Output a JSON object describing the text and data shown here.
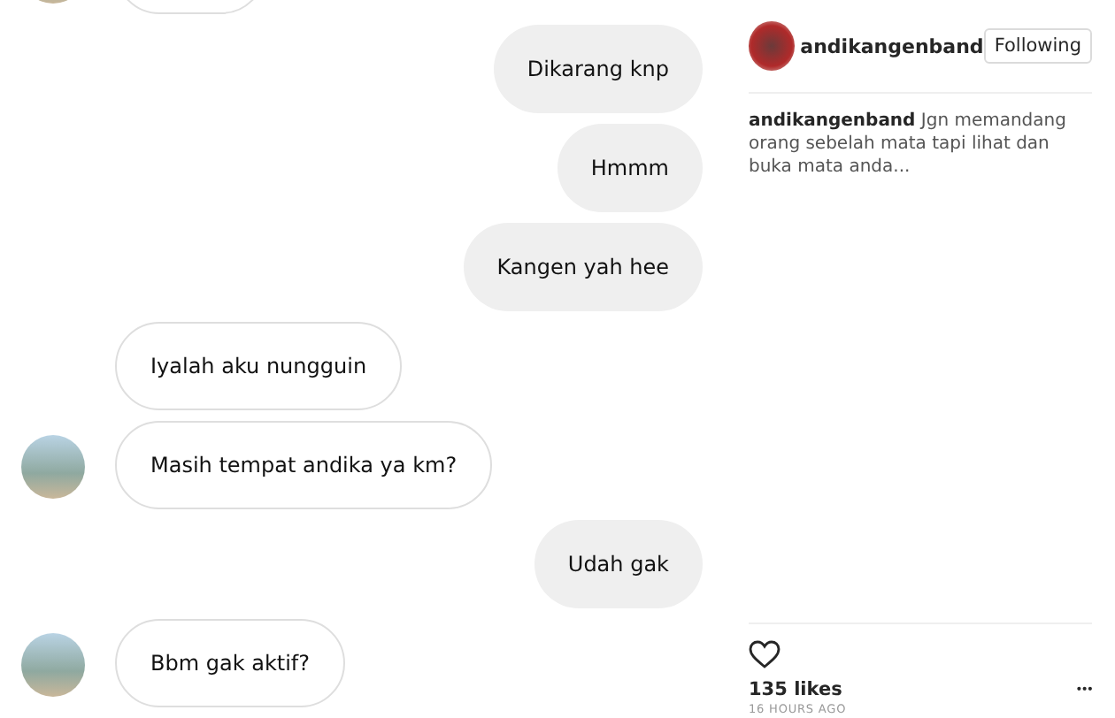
{
  "messages": [
    {
      "kind": "out",
      "text": "Dikarang knp"
    },
    {
      "kind": "out",
      "text": "Hmmm"
    },
    {
      "kind": "out",
      "text": "Kangen yah hee"
    },
    {
      "kind": "in",
      "avatar": false,
      "text": "Iyalah aku nungguin"
    },
    {
      "kind": "in",
      "avatar": true,
      "text": "Masih tempat andika ya km?"
    },
    {
      "kind": "out",
      "text": "Udah gak"
    },
    {
      "kind": "in",
      "avatar": true,
      "text": "Bbm gak aktif?"
    }
  ],
  "post": {
    "username": "andikangenband",
    "follow_button": "Following",
    "caption": "**andikangenband** Jgn memandang orang sebelah mata tapi lihat dan buka mata anda...",
    "liked": false,
    "likes": "135 likes",
    "more": "•••",
    "time": "16 HOURS AGO"
  }
}
